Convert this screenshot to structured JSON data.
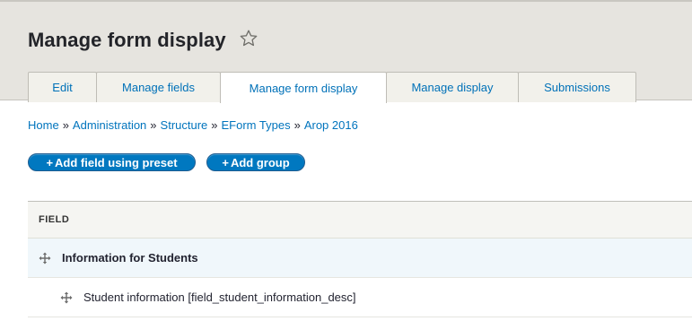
{
  "header": {
    "title": "Manage form display",
    "favorite_icon": "star-outline-icon"
  },
  "tabs": [
    {
      "label": "Edit",
      "active": false
    },
    {
      "label": "Manage fields",
      "active": false
    },
    {
      "label": "Manage form display",
      "active": true
    },
    {
      "label": "Manage display",
      "active": false
    },
    {
      "label": "Submissions",
      "active": false
    }
  ],
  "breadcrumb": {
    "items": [
      "Home",
      "Administration",
      "Structure",
      "EForm Types",
      "Arop 2016"
    ],
    "separator": "»"
  },
  "actions": {
    "add_field_preset": "Add field using preset",
    "add_group": "Add group",
    "plus_glyph": "+"
  },
  "table": {
    "column_header": "FIELD",
    "rows": [
      {
        "label": "Information for Students",
        "type": "group",
        "icon": "drag-handle-icon"
      },
      {
        "label": "Student information [field_student_information_desc]",
        "type": "child",
        "icon": "drag-handle-icon"
      }
    ]
  },
  "colors": {
    "accent": "#0078c0",
    "link": "#0074bd",
    "header_bg": "#e6e4df",
    "row_highlight": "#f0f7fb"
  }
}
